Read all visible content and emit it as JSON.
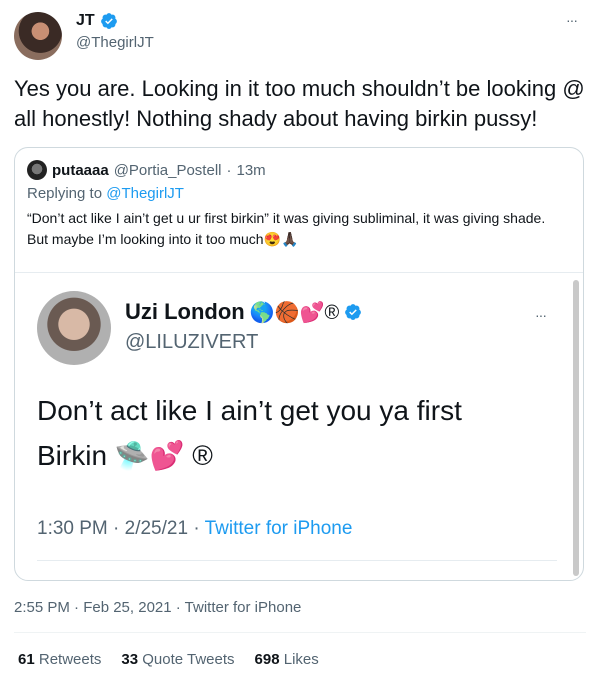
{
  "tweet": {
    "author_name": "JT",
    "author_handle": "@ThegirlJT",
    "more_label": "···",
    "text": "Yes you are. Looking in it too much shouldn’t be looking @ all honestly! Nothing shady about having birkin pussy!",
    "timestamp": "2:55 PM · Feb 25, 2021 · Twitter for iPhone",
    "stats": {
      "retweets_count": "61",
      "retweets_label": "Retweets",
      "quotes_count": "33",
      "quotes_label": "Quote Tweets",
      "likes_count": "698",
      "likes_label": "Likes"
    }
  },
  "quoted": {
    "author_name": "putaaaa",
    "author_handle": "@Portia_Postell",
    "time": "13m",
    "reply_prefix": "Replying to",
    "reply_handle": "@ThegirlJT",
    "text": "“Don’t act like I ain’t get u ur first birkin” it was giving subliminal, it was giving shade. But maybe I’m looking into it too much😍🙏🏿"
  },
  "embedded": {
    "author_name": "Uzi London",
    "author_emojis": "🌎🏀💕®",
    "author_handle": "@LILUZIVERT",
    "more_label": "···",
    "text_line1": "Don’t act like I ain’t get you ya first",
    "text_line2": "Birkin 🛸💕 ®",
    "time": "1:30 PM · 2/25/21 ·",
    "source": "Twitter for iPhone"
  },
  "colors": {
    "accent": "#1d9bf0",
    "muted": "#536471",
    "border": "#cfd9de"
  }
}
